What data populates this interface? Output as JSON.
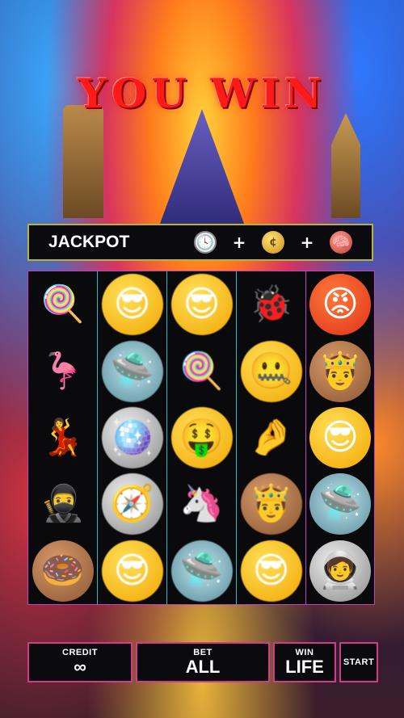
{
  "title": "YOU WIN",
  "jackpot": {
    "label": "JACKPOT",
    "items": [
      {
        "icon": "clock-icon",
        "glyph": "🕓"
      },
      {
        "icon": "coin-icon",
        "glyph": "¢"
      },
      {
        "icon": "brain-icon",
        "glyph": "🧠"
      }
    ],
    "plus": "+"
  },
  "reels": [
    [
      "🍭",
      "🦩",
      "💃",
      "🥷",
      "🍩"
    ],
    [
      "😎",
      "🛸",
      "🪩",
      "🧭",
      "😎"
    ],
    [
      "😎",
      "🍭",
      "🤑",
      "🦄",
      "🛸"
    ],
    [
      "🐞",
      "🤐",
      "🤌",
      "🤴",
      "😎"
    ],
    [
      "😡",
      "🤴",
      "😎",
      "🛸",
      "🧑‍🚀"
    ]
  ],
  "controls": {
    "credit": {
      "label": "CREDIT",
      "value": "∞"
    },
    "bet": {
      "label": "BET",
      "value": "ALL"
    },
    "win": {
      "label": "WIN",
      "value": "LIFE"
    },
    "start": {
      "label": "START"
    }
  },
  "colors": {
    "title": "#ff1a1a",
    "jackpot_border": "#b6b23a",
    "reel_border": "#c040c0",
    "control_border": "#d23a8a"
  }
}
